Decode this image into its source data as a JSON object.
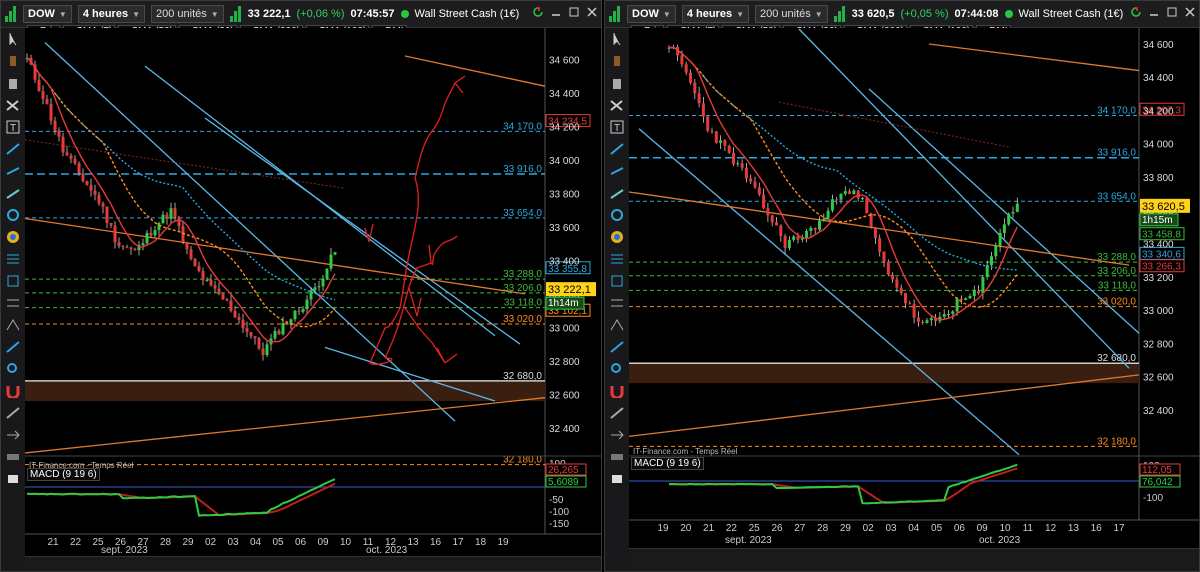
{
  "windows": [
    {
      "id": "left",
      "symbol": "DOW",
      "timeframe": "4 heures",
      "units": "200 unités",
      "quote": "33 222,1",
      "change": "(+0,06 %)",
      "time": "07:45:57",
      "instrument": "Wall Street Cash (1€)",
      "legend": [
        {
          "label": "Prix",
          "color": "#2ecc40"
        },
        {
          "label": "SMA (7)",
          "color": "#e83a3a"
        },
        {
          "label": "SMA (50)",
          "color": "#2aa8e0"
        },
        {
          "label": "SMA (20)",
          "color": "#ff8c1a"
        },
        {
          "label": "SMA (200)",
          "color": "#c0201e"
        },
        {
          "label": "SMA (100)",
          "color": "#777777"
        },
        {
          "label": "DMI",
          "color": "#555555"
        }
      ],
      "price_labels": [
        "34 600",
        "34 400",
        "34 200",
        "34 000",
        "33 800",
        "33 600",
        "33 400",
        "33 200",
        "33 000",
        "32 800",
        "32 600",
        "32 400"
      ],
      "level_labels": [
        {
          "text": "34 170,0",
          "color": "#2aa8e0"
        },
        {
          "text": "34 234,5",
          "color": "#e83a3a"
        },
        {
          "text": "33 916,0",
          "color": "#2aa8e0"
        },
        {
          "text": "33 654,0",
          "color": "#2aa8e0"
        },
        {
          "text": "33 355,8",
          "color": "#2aa8e0"
        },
        {
          "text": "33 288,0",
          "color": "#3dbb3d"
        },
        {
          "text": "33 206,0",
          "color": "#3dbb3d"
        },
        {
          "text": "33 118,0",
          "color": "#3dbb3d"
        },
        {
          "text": "33 102,1",
          "color": "#ff8c1a"
        },
        {
          "text": "33 020,0",
          "color": "#ff8c1a"
        },
        {
          "text": "32 680,0",
          "color": "#dddddd"
        },
        {
          "text": "32 180,0",
          "color": "#ff8c1a"
        }
      ],
      "current_price": "33 222,1",
      "countdown": "1h14m",
      "source": "IT-Finance.com - Temps Réel",
      "macd_label": "MACD (9 19 6)",
      "macd_values": [
        "26,265",
        "5,6089"
      ],
      "macd_ticks": [
        "100",
        "50",
        "-50",
        "-100",
        "-150"
      ],
      "x_days": [
        "21",
        "22",
        "25",
        "26",
        "27",
        "28",
        "29",
        "02",
        "03",
        "04",
        "05",
        "06",
        "09",
        "10",
        "11",
        "12",
        "13",
        "16",
        "17",
        "18",
        "19"
      ],
      "x_months": [
        "sept. 2023",
        "oct. 2023"
      ]
    },
    {
      "id": "right",
      "symbol": "DOW",
      "timeframe": "4 heures",
      "units": "200 unités",
      "quote": "33 620,5",
      "change": "(+0,05 %)",
      "time": "07:44:08",
      "instrument": "Wall Street Cash (1€)",
      "legend": [
        {
          "label": "Prix",
          "color": "#2ecc40"
        },
        {
          "label": "SMA (7)",
          "color": "#e83a3a"
        },
        {
          "label": "SMA (50)",
          "color": "#2aa8e0"
        },
        {
          "label": "SMA (20)",
          "color": "#ff8c1a"
        },
        {
          "label": "SMA (200)",
          "color": "#c0201e"
        },
        {
          "label": "SMA (100)",
          "color": "#777777"
        },
        {
          "label": "DMI",
          "color": "#555555"
        }
      ],
      "price_labels": [
        "34 600",
        "34 400",
        "34 200",
        "34 000",
        "33 800",
        "33 600",
        "33 400",
        "33 200",
        "33 000",
        "32 800",
        "32 600",
        "32 400"
      ],
      "level_labels": [
        {
          "text": "34 170,0",
          "color": "#2aa8e0"
        },
        {
          "text": "34 207,3",
          "color": "#e83a3a"
        },
        {
          "text": "33 916,0",
          "color": "#2aa8e0"
        },
        {
          "text": "33 654,0",
          "color": "#2aa8e0"
        },
        {
          "text": "33 458,8",
          "color": "#3dbb3d"
        },
        {
          "text": "33 340,6",
          "color": "#2aa8e0"
        },
        {
          "text": "33 288,0",
          "color": "#3dbb3d"
        },
        {
          "text": "33 266,3",
          "color": "#e83a3a"
        },
        {
          "text": "33 206,0",
          "color": "#3dbb3d"
        },
        {
          "text": "33 118,0",
          "color": "#3dbb3d"
        },
        {
          "text": "33 020,0",
          "color": "#ff8c1a"
        },
        {
          "text": "32 680,0",
          "color": "#dddddd"
        },
        {
          "text": "32 180,0",
          "color": "#ff8c1a"
        }
      ],
      "current_price": "33 620,5",
      "countdown": "1h15m",
      "source": "IT-Finance.com - Temps Réel",
      "macd_label": "MACD (9 19 6)",
      "macd_values": [
        "112,05",
        "76,042"
      ],
      "macd_ticks": [
        "100",
        "0",
        "-100"
      ],
      "x_days": [
        "19",
        "20",
        "21",
        "22",
        "25",
        "26",
        "27",
        "28",
        "29",
        "02",
        "03",
        "04",
        "05",
        "06",
        "09",
        "10",
        "11",
        "12",
        "13",
        "16",
        "17"
      ],
      "x_months": [
        "sept. 2023",
        "oct. 2023"
      ]
    }
  ]
}
